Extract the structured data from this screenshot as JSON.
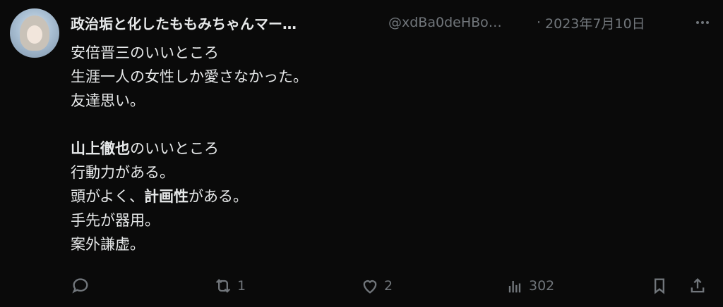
{
  "author": {
    "display_name": "政治垢と化したももみちゃんマー…",
    "handle": "@xdBa0deHBo…",
    "separator": "·",
    "date": "2023年7月10日"
  },
  "post": {
    "lines": [
      [
        {
          "text": "安倍晋三のいいところ",
          "bold": false
        }
      ],
      [
        {
          "text": "生涯一人の女性しか愛さなかった。",
          "bold": false
        }
      ],
      [
        {
          "text": "友達思い。",
          "bold": false
        }
      ],
      [],
      [
        {
          "text": "山上徹也",
          "bold": true
        },
        {
          "text": "のいいところ",
          "bold": false
        }
      ],
      [
        {
          "text": "行動力がある。",
          "bold": false
        }
      ],
      [
        {
          "text": "頭がよく、",
          "bold": false
        },
        {
          "text": "計画性",
          "bold": true
        },
        {
          "text": "がある。",
          "bold": false
        }
      ],
      [
        {
          "text": "手先が器用。",
          "bold": false
        }
      ],
      [
        {
          "text": "案外謙虚。",
          "bold": false
        }
      ]
    ]
  },
  "actions": {
    "reply_count": "",
    "repost_count": "1",
    "like_count": "2",
    "views_count": "302"
  },
  "icons": {
    "avatar": "anime-girl-avatar",
    "more": "ellipsis-icon",
    "reply": "speech-bubble-icon",
    "repost": "repost-arrows-icon",
    "like": "heart-icon",
    "views": "bar-chart-icon",
    "bookmark": "bookmark-icon",
    "share": "share-upload-icon"
  }
}
